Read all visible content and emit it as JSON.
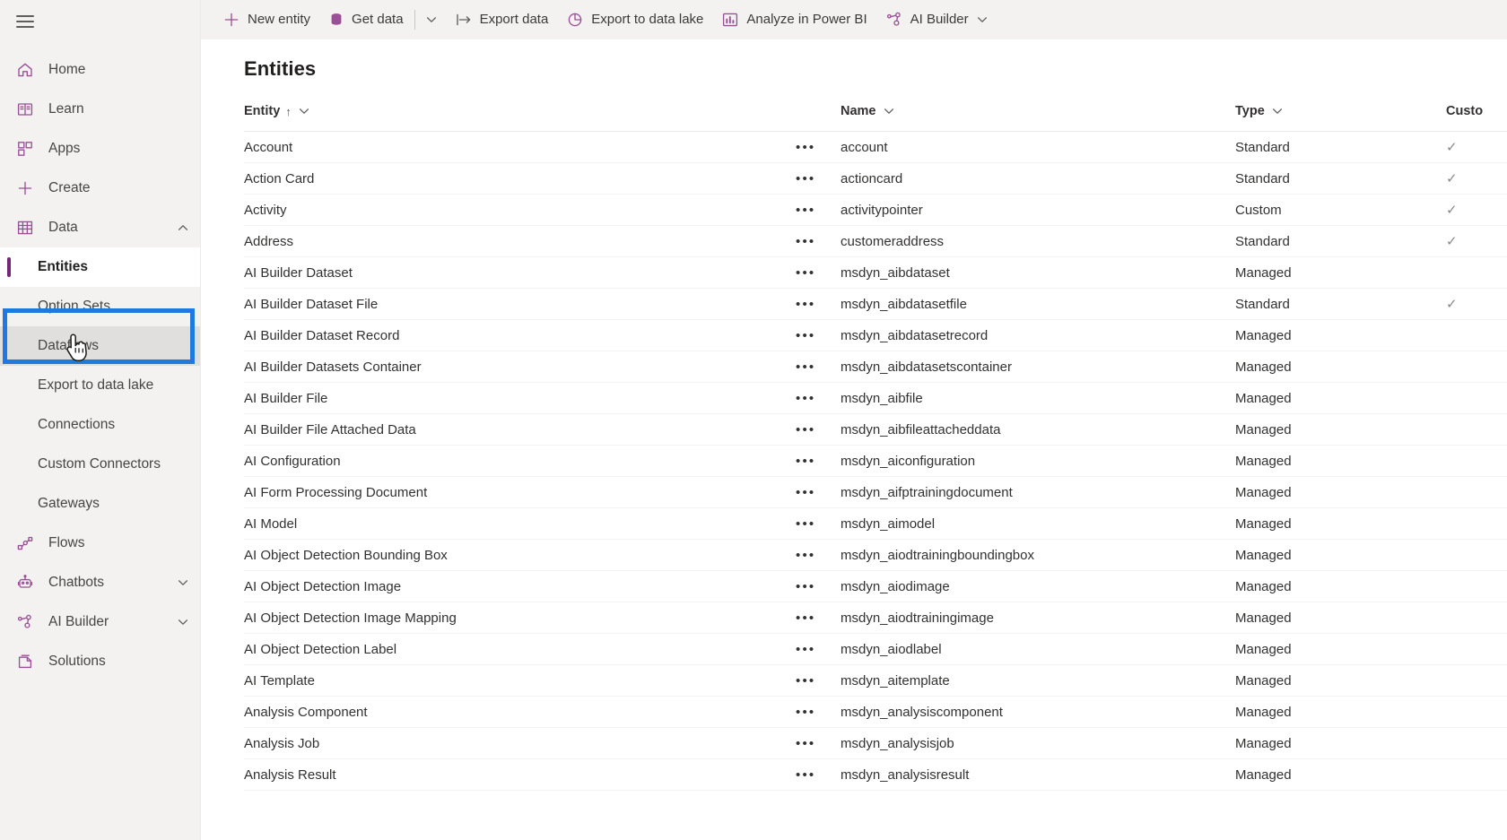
{
  "theme": {
    "sidebar_bg": "#f3f2f1",
    "accent_purple": "#742774",
    "icon_purple": "#9b4f96",
    "focus_blue": "#1f7ae0",
    "text_primary": "#201f1e",
    "text_secondary": "#605e5c"
  },
  "sidebar": {
    "menu_toggle": "hamburger-menu-icon",
    "items": [
      {
        "label": "Home",
        "icon": "home-icon",
        "kind": "top",
        "chevron": null
      },
      {
        "label": "Learn",
        "icon": "book-icon",
        "kind": "top",
        "chevron": null
      },
      {
        "label": "Apps",
        "icon": "apps-grid-icon",
        "kind": "top",
        "chevron": null
      },
      {
        "label": "Create",
        "icon": "plus-icon",
        "kind": "top",
        "chevron": null
      },
      {
        "label": "Data",
        "icon": "table-icon",
        "kind": "top",
        "chevron": "up"
      },
      {
        "label": "Entities",
        "icon": null,
        "kind": "sub",
        "state": "selected"
      },
      {
        "label": "Option Sets",
        "icon": null,
        "kind": "sub",
        "state": "default"
      },
      {
        "label": "Dataflows",
        "icon": null,
        "kind": "sub",
        "state": "hovered"
      },
      {
        "label": "Export to data lake",
        "icon": null,
        "kind": "sub",
        "state": "default"
      },
      {
        "label": "Connections",
        "icon": null,
        "kind": "sub",
        "state": "default"
      },
      {
        "label": "Custom Connectors",
        "icon": null,
        "kind": "sub",
        "state": "default"
      },
      {
        "label": "Gateways",
        "icon": null,
        "kind": "sub",
        "state": "default"
      },
      {
        "label": "Flows",
        "icon": "flow-icon",
        "kind": "top",
        "chevron": null
      },
      {
        "label": "Chatbots",
        "icon": "robot-icon",
        "kind": "top",
        "chevron": "down"
      },
      {
        "label": "AI Builder",
        "icon": "ai-builder-icon",
        "kind": "top",
        "chevron": "down"
      },
      {
        "label": "Solutions",
        "icon": "solutions-icon",
        "kind": "top",
        "chevron": null
      }
    ]
  },
  "command_bar": {
    "items": [
      {
        "label": "New entity",
        "icon": "plus-icon"
      },
      {
        "label": "Get data",
        "icon": "database-icon",
        "has_split_caret": true
      },
      {
        "label": "Export data",
        "icon": "export-arrow-icon"
      },
      {
        "label": "Export to data lake",
        "icon": "pie-chart-icon"
      },
      {
        "label": "Analyze in Power BI",
        "icon": "power-bi-icon"
      },
      {
        "label": "AI Builder",
        "icon": "ai-builder-icon",
        "has_caret": true
      }
    ]
  },
  "page": {
    "title": "Entities"
  },
  "table": {
    "columns": [
      {
        "key": "entity",
        "label": "Entity",
        "sorted": "asc",
        "has_chevron": true
      },
      {
        "key": "dots",
        "label": "",
        "sorted": null,
        "has_chevron": false
      },
      {
        "key": "name",
        "label": "Name",
        "sorted": null,
        "has_chevron": true
      },
      {
        "key": "type",
        "label": "Type",
        "sorted": null,
        "has_chevron": true
      },
      {
        "key": "custom",
        "label": "Custo",
        "sorted": null,
        "has_chevron": false
      }
    ],
    "row_menu_glyph": "•••",
    "check_glyph": "✓",
    "rows": [
      {
        "entity": "Account",
        "name": "account",
        "type": "Standard",
        "custom": true
      },
      {
        "entity": "Action Card",
        "name": "actioncard",
        "type": "Standard",
        "custom": true
      },
      {
        "entity": "Activity",
        "name": "activitypointer",
        "type": "Custom",
        "custom": true
      },
      {
        "entity": "Address",
        "name": "customeraddress",
        "type": "Standard",
        "custom": true
      },
      {
        "entity": "AI Builder Dataset",
        "name": "msdyn_aibdataset",
        "type": "Managed",
        "custom": false
      },
      {
        "entity": "AI Builder Dataset File",
        "name": "msdyn_aibdatasetfile",
        "type": "Standard",
        "custom": true
      },
      {
        "entity": "AI Builder Dataset Record",
        "name": "msdyn_aibdatasetrecord",
        "type": "Managed",
        "custom": false
      },
      {
        "entity": "AI Builder Datasets Container",
        "name": "msdyn_aibdatasetscontainer",
        "type": "Managed",
        "custom": false
      },
      {
        "entity": "AI Builder File",
        "name": "msdyn_aibfile",
        "type": "Managed",
        "custom": false
      },
      {
        "entity": "AI Builder File Attached Data",
        "name": "msdyn_aibfileattacheddata",
        "type": "Managed",
        "custom": false
      },
      {
        "entity": "AI Configuration",
        "name": "msdyn_aiconfiguration",
        "type": "Managed",
        "custom": false
      },
      {
        "entity": "AI Form Processing Document",
        "name": "msdyn_aifptrainingdocument",
        "type": "Managed",
        "custom": false
      },
      {
        "entity": "AI Model",
        "name": "msdyn_aimodel",
        "type": "Managed",
        "custom": false
      },
      {
        "entity": "AI Object Detection Bounding Box",
        "name": "msdyn_aiodtrainingboundingbox",
        "type": "Managed",
        "custom": false
      },
      {
        "entity": "AI Object Detection Image",
        "name": "msdyn_aiodimage",
        "type": "Managed",
        "custom": false
      },
      {
        "entity": "AI Object Detection Image Mapping",
        "name": "msdyn_aiodtrainingimage",
        "type": "Managed",
        "custom": false
      },
      {
        "entity": "AI Object Detection Label",
        "name": "msdyn_aiodlabel",
        "type": "Managed",
        "custom": false
      },
      {
        "entity": "AI Template",
        "name": "msdyn_aitemplate",
        "type": "Managed",
        "custom": false
      },
      {
        "entity": "Analysis Component",
        "name": "msdyn_analysiscomponent",
        "type": "Managed",
        "custom": false
      },
      {
        "entity": "Analysis Job",
        "name": "msdyn_analysisjob",
        "type": "Managed",
        "custom": false
      },
      {
        "entity": "Analysis Result",
        "name": "msdyn_analysisresult",
        "type": "Managed",
        "custom": false
      }
    ]
  }
}
